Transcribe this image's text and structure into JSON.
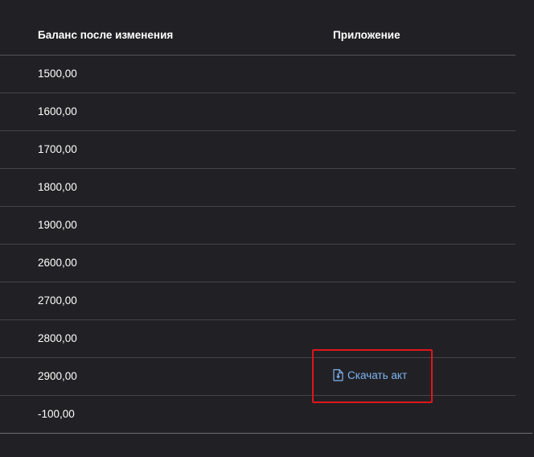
{
  "table": {
    "headers": {
      "balance": "Баланс после изменения",
      "attachment": "Приложение"
    },
    "rows": [
      {
        "balance": "1500,00",
        "attachment": ""
      },
      {
        "balance": "1600,00",
        "attachment": ""
      },
      {
        "balance": "1700,00",
        "attachment": ""
      },
      {
        "balance": "1800,00",
        "attachment": ""
      },
      {
        "balance": "1900,00",
        "attachment": ""
      },
      {
        "balance": "2600,00",
        "attachment": ""
      },
      {
        "balance": "2700,00",
        "attachment": ""
      },
      {
        "balance": "2800,00",
        "attachment": ""
      },
      {
        "balance": "2900,00",
        "attachment": "Скачать акт"
      },
      {
        "balance": "-100,00",
        "attachment": ""
      }
    ]
  },
  "colors": {
    "background": "#212125",
    "link": "#7fb3f0",
    "highlight": "#e0151c"
  },
  "icons": {
    "download": "download-document-icon"
  }
}
